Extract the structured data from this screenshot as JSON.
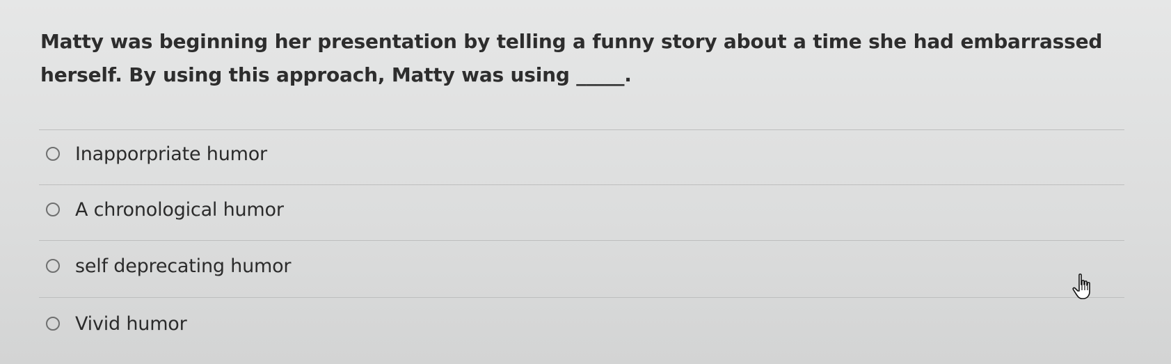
{
  "question": {
    "text": "Matty was beginning her presentation by telling a funny story about a time she had embarrassed herself. By using this approach, Matty was using _____."
  },
  "options": [
    {
      "label": "Inapporpriate humor",
      "selected": false
    },
    {
      "label": "A chronological humor",
      "selected": false
    },
    {
      "label": "self deprecating humor",
      "selected": false
    },
    {
      "label": "Vivid humor",
      "selected": false
    }
  ],
  "cursor": {
    "icon": "hand-pointer-icon"
  }
}
